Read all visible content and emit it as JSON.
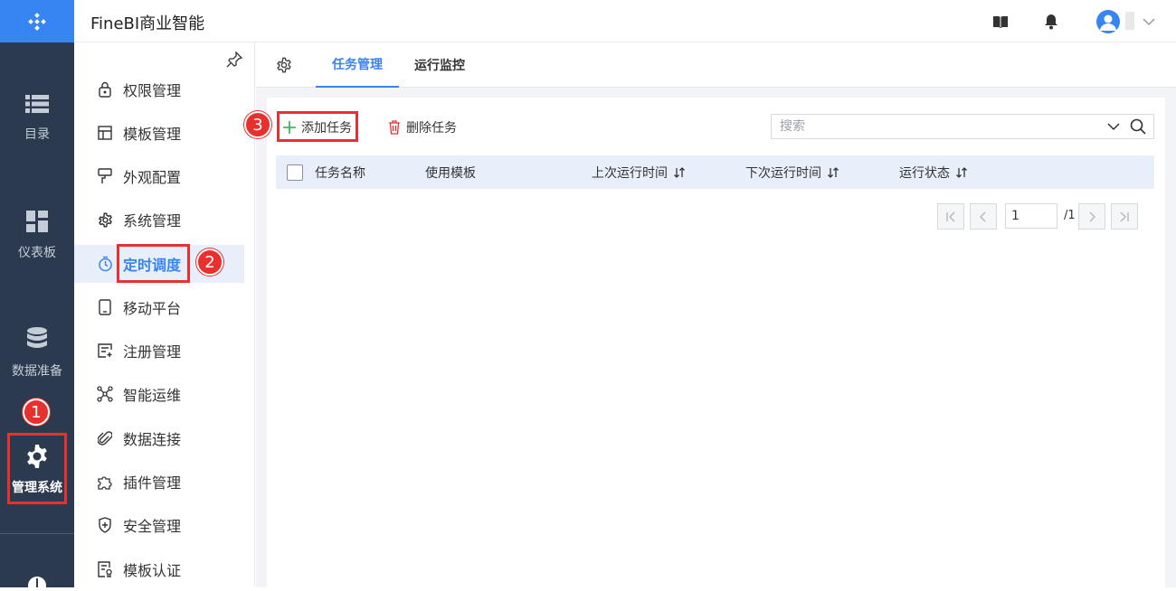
{
  "app": {
    "title": "FineBI商业智能"
  },
  "rail": {
    "items": [
      {
        "label": "目录",
        "icon": "list-icon"
      },
      {
        "label": "仪表板",
        "icon": "dashboard-icon"
      },
      {
        "label": "数据准备",
        "icon": "database-icon"
      },
      {
        "label": "管理系统",
        "icon": "gear-icon",
        "active": true
      }
    ]
  },
  "subnav": {
    "items": [
      {
        "label": "权限管理",
        "icon": "lock-icon"
      },
      {
        "label": "模板管理",
        "icon": "template-icon"
      },
      {
        "label": "外观配置",
        "icon": "paint-icon"
      },
      {
        "label": "系统管理",
        "icon": "gear-icon"
      },
      {
        "label": "定时调度",
        "icon": "timer-icon",
        "active": true
      },
      {
        "label": "移动平台",
        "icon": "mobile-icon"
      },
      {
        "label": "注册管理",
        "icon": "register-icon"
      },
      {
        "label": "智能运维",
        "icon": "network-icon"
      },
      {
        "label": "数据连接",
        "icon": "paperclip-icon"
      },
      {
        "label": "插件管理",
        "icon": "puzzle-icon"
      },
      {
        "label": "安全管理",
        "icon": "shield-icon"
      },
      {
        "label": "模板认证",
        "icon": "certificate-icon"
      }
    ]
  },
  "tabs": [
    {
      "label": "任务管理",
      "active": true
    },
    {
      "label": "运行监控",
      "active": false
    }
  ],
  "toolbar": {
    "add_label": "添加任务",
    "delete_label": "删除任务"
  },
  "search": {
    "placeholder": "搜索"
  },
  "table": {
    "columns": [
      "任务名称",
      "使用模板",
      "上次运行时间",
      "下次运行时间",
      "运行状态"
    ],
    "rows": []
  },
  "pagination": {
    "current": "1",
    "total": "/1"
  },
  "callouts": [
    "1",
    "2",
    "3"
  ],
  "colors": {
    "accent": "#3685f2",
    "rail_bg": "#2b3a4e",
    "callout": "#e8302f"
  }
}
